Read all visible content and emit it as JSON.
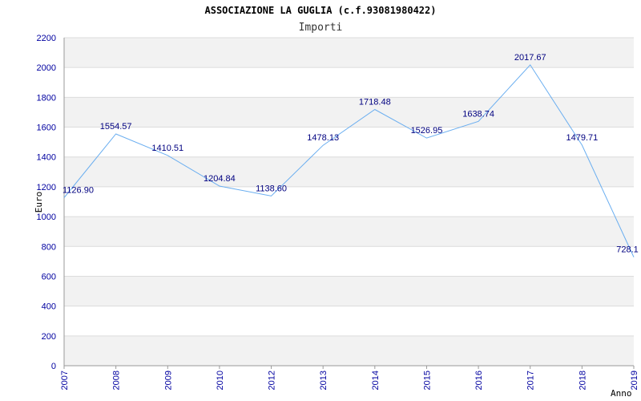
{
  "chart_data": {
    "type": "line",
    "title": "ASSOCIAZIONE LA GUGLIA (c.f.93081980422)",
    "subtitle": "Importi",
    "xlabel": "Anno",
    "ylabel": "Euro",
    "categories": [
      "2007",
      "2008",
      "2009",
      "2010",
      "2012",
      "2013",
      "2014",
      "2015",
      "2016",
      "2017",
      "2018",
      "2019"
    ],
    "series": [
      {
        "values": [
          1126.9,
          1554.57,
          1410.51,
          1204.84,
          1138.6,
          1478.13,
          1718.48,
          1526.95,
          1638.74,
          2017.67,
          1479.71,
          728.1
        ],
        "labels": [
          "1126.90",
          "1554.57",
          "1410.51",
          "1204.84",
          "1138.60",
          "1478.13",
          "1718.48",
          "1526.95",
          "1638.74",
          "2017.67",
          "1479.71",
          "728.1"
        ]
      }
    ],
    "ylim": [
      0,
      2200
    ],
    "yticks": [
      "0",
      "200",
      "400",
      "600",
      "800",
      "1000",
      "1200",
      "1400",
      "1600",
      "1800",
      "2000",
      "2200"
    ],
    "grid": true,
    "band_colors": [
      "#f2f2f2",
      "#ffffff"
    ],
    "line_color": "#6aaef0",
    "tick_color": "#0000a0"
  }
}
